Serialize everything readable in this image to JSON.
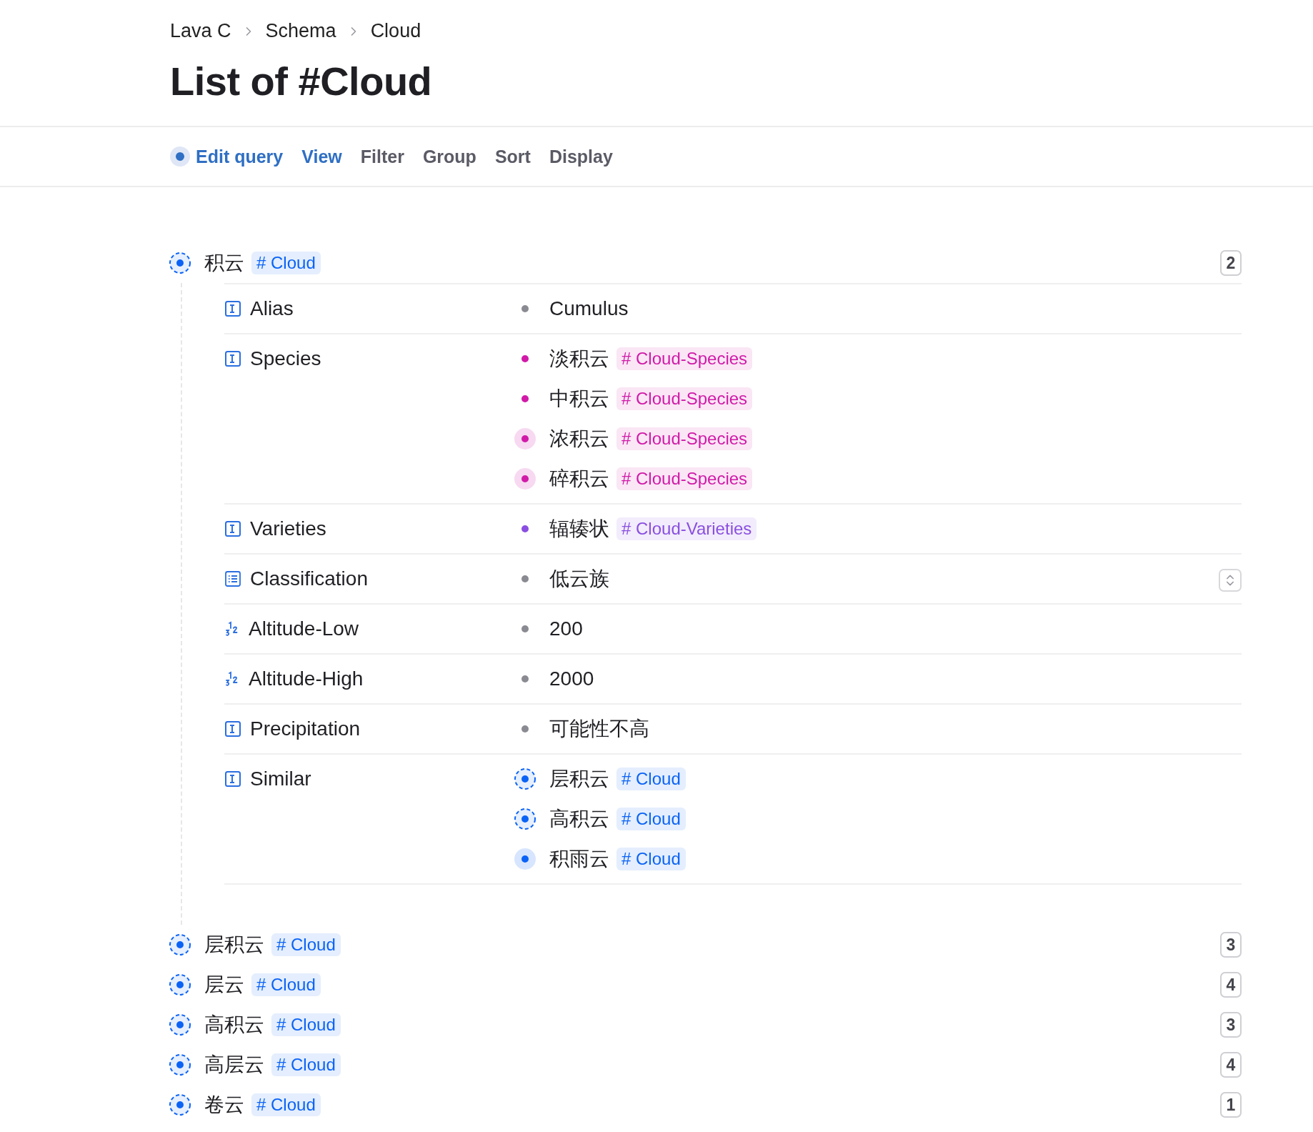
{
  "breadcrumb": [
    "Lava C",
    "Schema",
    "Cloud"
  ],
  "title": "List of #Cloud",
  "toolbar": [
    {
      "label": "Edit query",
      "active": true,
      "kind": "query"
    },
    {
      "label": "View",
      "active": true,
      "kind": "plain"
    },
    {
      "label": "Filter",
      "active": false,
      "kind": "plain"
    },
    {
      "label": "Group",
      "active": false,
      "kind": "plain"
    },
    {
      "label": "Sort",
      "active": false,
      "kind": "plain"
    },
    {
      "label": "Display",
      "active": false,
      "kind": "plain"
    }
  ],
  "items": [
    {
      "title": "积云",
      "kind": "ring",
      "tag": {
        "label": "# Cloud",
        "color": "#0b63f6"
      },
      "count": "2",
      "properties": [
        {
          "name": "Alias",
          "kind": "text",
          "values": [
            {
              "text": "Cumulus",
              "kind": "dot"
            }
          ]
        },
        {
          "name": "Species",
          "kind": "text",
          "values": [
            {
              "text": "淡积云",
              "kind": "dot",
              "tag": {
                "label": "# Cloud-Species",
                "color": "#d11aa8"
              }
            },
            {
              "text": "中积云",
              "kind": "dot",
              "tag": {
                "label": "# Cloud-Species",
                "color": "#d11aa8"
              }
            },
            {
              "text": "浓积云",
              "kind": "halo",
              "tag": {
                "label": "# Cloud-Species",
                "color": "#d11aa8"
              }
            },
            {
              "text": "碎积云",
              "kind": "halo",
              "tag": {
                "label": "# Cloud-Species",
                "color": "#d11aa8"
              }
            }
          ]
        },
        {
          "name": "Varieties",
          "kind": "text",
          "values": [
            {
              "text": "辐辏状",
              "kind": "dot",
              "tag": {
                "label": "# Cloud-Varieties",
                "color": "#8a4fe0"
              }
            }
          ]
        },
        {
          "name": "Classification",
          "kind": "select",
          "stepper": true,
          "values": [
            {
              "text": "低云族",
              "kind": "dot"
            }
          ]
        },
        {
          "name": "Altitude-Low",
          "kind": "number",
          "values": [
            {
              "text": "200",
              "kind": "dot"
            }
          ]
        },
        {
          "name": "Altitude-High",
          "kind": "number",
          "values": [
            {
              "text": "2000",
              "kind": "dot"
            }
          ]
        },
        {
          "name": "Precipitation",
          "kind": "text",
          "values": [
            {
              "text": "可能性不高",
              "kind": "dot"
            }
          ]
        },
        {
          "name": "Similar",
          "kind": "text",
          "values": [
            {
              "text": "层积云",
              "kind": "ring",
              "tag": {
                "label": "# Cloud",
                "color": "#0b63f6"
              }
            },
            {
              "text": "高积云",
              "kind": "ring",
              "tag": {
                "label": "# Cloud",
                "color": "#0b63f6"
              }
            },
            {
              "text": "积雨云",
              "kind": "halo",
              "tag": {
                "label": "# Cloud",
                "color": "#0b63f6"
              }
            }
          ]
        }
      ]
    },
    {
      "title": "层积云",
      "kind": "ring",
      "tag": {
        "label": "# Cloud",
        "color": "#0b63f6"
      },
      "count": "3"
    },
    {
      "title": "层云",
      "kind": "ring",
      "tag": {
        "label": "# Cloud",
        "color": "#0b63f6"
      },
      "count": "4"
    },
    {
      "title": "高积云",
      "kind": "ring",
      "tag": {
        "label": "# Cloud",
        "color": "#0b63f6"
      },
      "count": "3"
    },
    {
      "title": "高层云",
      "kind": "ring",
      "tag": {
        "label": "# Cloud",
        "color": "#0b63f6"
      },
      "count": "4"
    },
    {
      "title": "卷云",
      "kind": "ring",
      "tag": {
        "label": "# Cloud",
        "color": "#0b63f6"
      },
      "count": "1"
    }
  ]
}
